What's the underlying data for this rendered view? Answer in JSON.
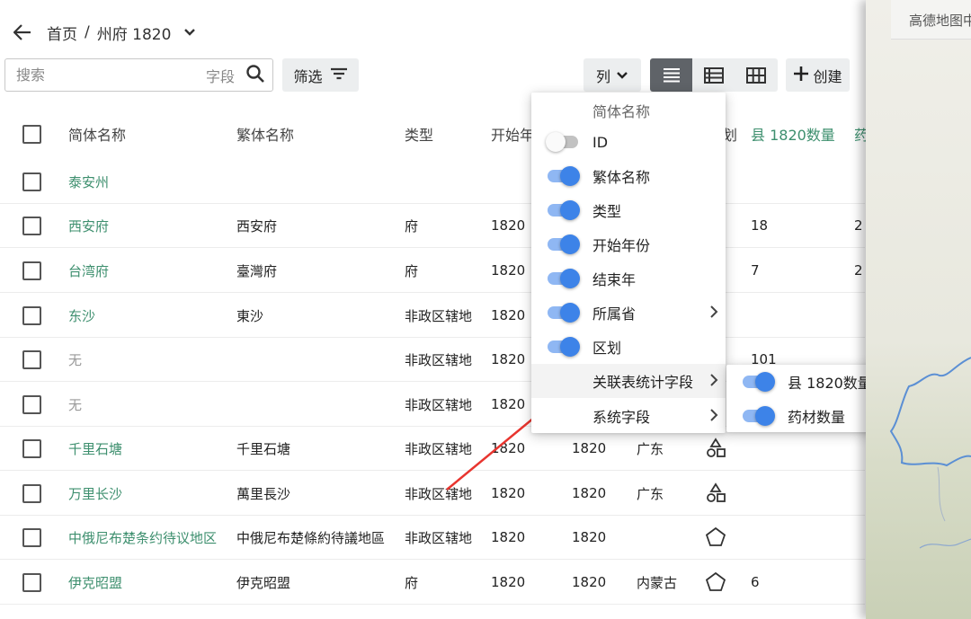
{
  "breadcrumb": {
    "home": "首页",
    "separator": "/",
    "current": "州府 1820"
  },
  "toolbar": {
    "search_placeholder": "搜索",
    "search_field_label": "字段",
    "filter_label": "筛选",
    "columns_label": "列",
    "create_label": "创建"
  },
  "table": {
    "headers": [
      "简体名称",
      "繁体名称",
      "类型",
      "开始年",
      "",
      "",
      "划",
      "县 1820数量",
      "药"
    ],
    "rows": [
      {
        "name": "泰安州",
        "trad": "",
        "type": "",
        "start": "",
        "end": "",
        "prov": "",
        "shape": "",
        "county": "",
        "herb": "",
        "muted": false
      },
      {
        "name": "西安府",
        "trad": "西安府",
        "type": "府",
        "start": "1820",
        "end": "",
        "prov": "",
        "shape": "",
        "county": "18",
        "herb": "2",
        "muted": false
      },
      {
        "name": "台湾府",
        "trad": "臺灣府",
        "type": "府",
        "start": "1820",
        "end": "",
        "prov": "",
        "shape": "",
        "county": "7",
        "herb": "2",
        "muted": false
      },
      {
        "name": "东沙",
        "trad": "東沙",
        "type": "非政区辖地",
        "start": "1820",
        "end": "",
        "prov": "",
        "shape": "",
        "county": "",
        "herb": "",
        "muted": false
      },
      {
        "name": "无",
        "trad": "",
        "type": "非政区辖地",
        "start": "1820",
        "end": "",
        "prov": "",
        "shape": "",
        "county": "101",
        "herb": "",
        "muted": true
      },
      {
        "name": "无",
        "trad": "",
        "type": "非政区辖地",
        "start": "1820",
        "end": "",
        "prov": "",
        "shape": "",
        "county": "",
        "herb": "",
        "muted": true
      },
      {
        "name": "千里石塘",
        "trad": "千里石塘",
        "type": "非政区辖地",
        "start": "1820",
        "end": "1820",
        "prov": "广东",
        "shape": "shapes-icon",
        "county": "",
        "herb": "",
        "muted": false
      },
      {
        "name": "万里长沙",
        "trad": "萬里長沙",
        "type": "非政区辖地",
        "start": "1820",
        "end": "1820",
        "prov": "广东",
        "shape": "shapes-icon",
        "county": "",
        "herb": "",
        "muted": false
      },
      {
        "name": "中俄尼布楚条约待议地区",
        "trad": "中俄尼布楚條約待議地區",
        "type": "非政区辖地",
        "start": "1820",
        "end": "1820",
        "prov": "",
        "shape": "pentagon-icon",
        "county": "",
        "herb": "",
        "muted": false
      },
      {
        "name": "伊克昭盟",
        "trad": "伊克昭盟",
        "type": "府",
        "start": "1820",
        "end": "1820",
        "prov": "内蒙古",
        "shape": "pentagon-icon",
        "county": "6",
        "herb": "",
        "muted": false
      }
    ]
  },
  "column_menu": {
    "header": "简体名称",
    "items": [
      {
        "label": "ID",
        "on": false,
        "submenu": false
      },
      {
        "label": "繁体名称",
        "on": true,
        "submenu": false
      },
      {
        "label": "类型",
        "on": true,
        "submenu": false
      },
      {
        "label": "开始年份",
        "on": true,
        "submenu": false
      },
      {
        "label": "结束年",
        "on": true,
        "submenu": false
      },
      {
        "label": "所属省",
        "on": true,
        "submenu": true
      },
      {
        "label": "区划",
        "on": true,
        "submenu": false
      }
    ],
    "groups": [
      {
        "label": "关联表统计字段"
      },
      {
        "label": "系统字段"
      }
    ]
  },
  "sub_menu": {
    "items": [
      {
        "label": "县 1820数量",
        "on": true
      },
      {
        "label": "药材数量",
        "on": true
      }
    ]
  },
  "map": {
    "header": "高德地图中"
  },
  "colors": {
    "accent": "#3d8f6e",
    "toggle": "#3d83e8",
    "annotation_arrow": "#e8352f"
  }
}
